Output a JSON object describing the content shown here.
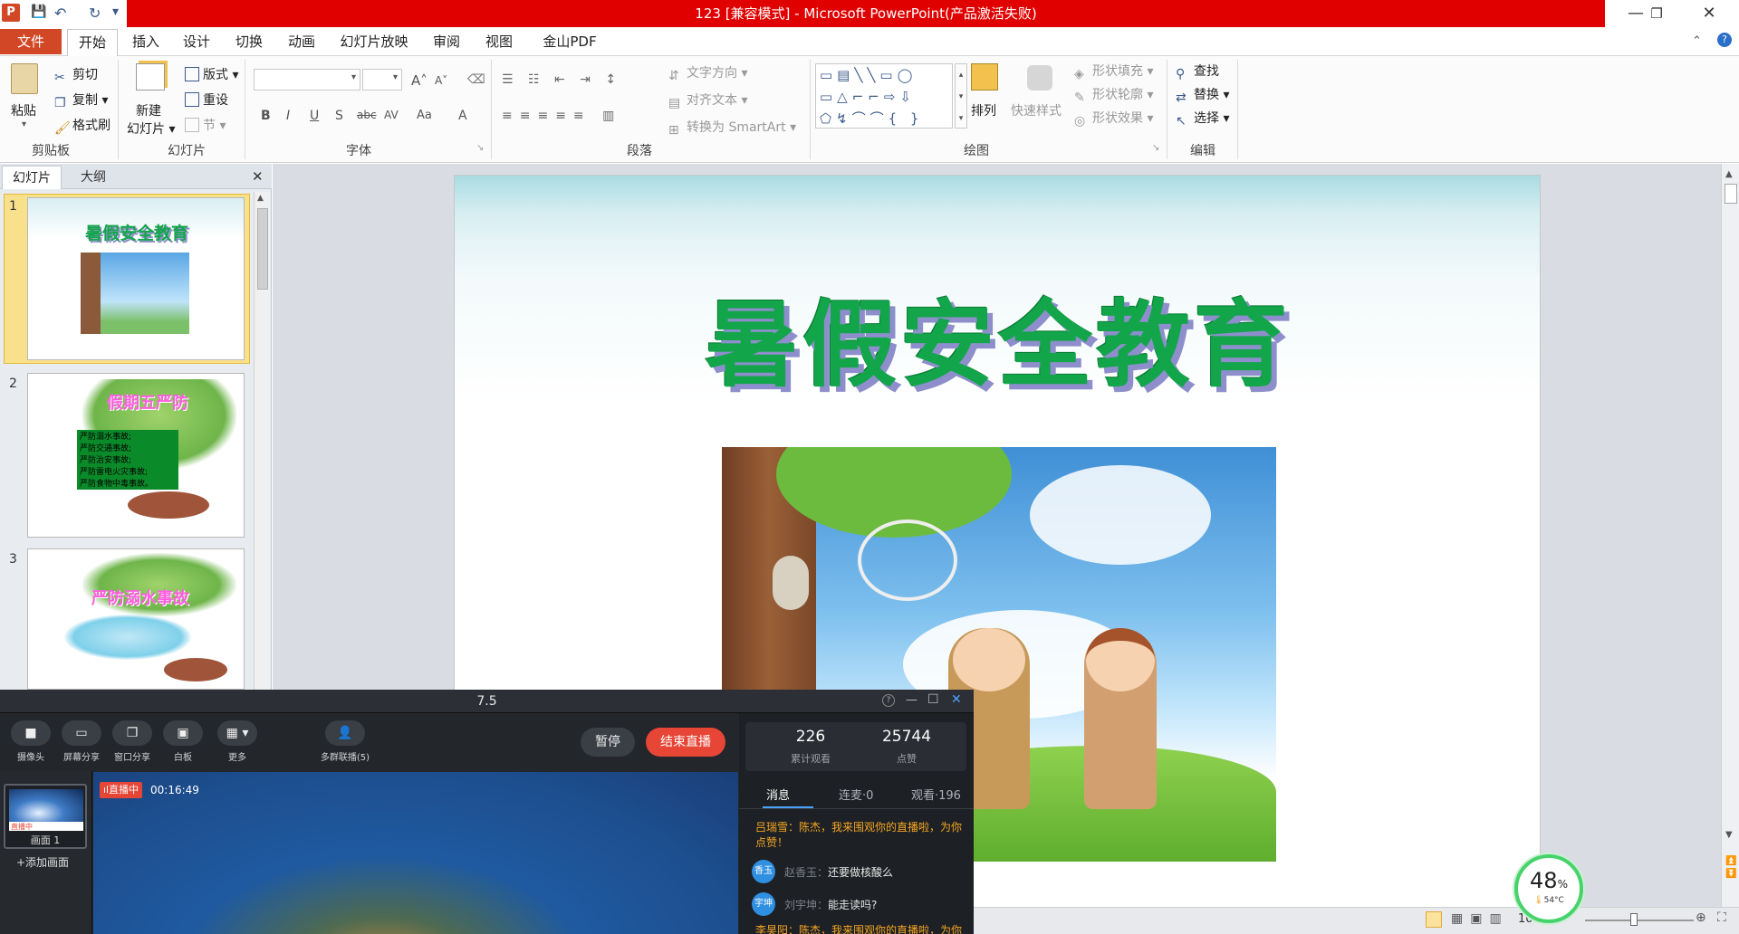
{
  "window": {
    "title": "123 [兼容模式] - Microsoft PowerPoint(产品激活失败)",
    "app_icon": "P",
    "qa_save": "💾",
    "qa_undo": "↶",
    "qa_redo": "↻",
    "qa_dropdown": "▾"
  },
  "menu": {
    "file": "文件",
    "tabs": [
      "开始",
      "插入",
      "设计",
      "切换",
      "动画",
      "幻灯片放映",
      "审阅",
      "视图",
      "金山PDF"
    ]
  },
  "ribbon": {
    "clipboard": {
      "paste": "粘贴",
      "cut": "剪切",
      "copy": "复制",
      "format_painter": "格式刷",
      "label": "剪贴板"
    },
    "slides": {
      "new_slide_1": "新建",
      "new_slide_2": "幻灯片",
      "layout": "版式",
      "reset": "重设",
      "section": "节",
      "label": "幻灯片"
    },
    "font": {
      "label": "字体",
      "bold": "B",
      "italic": "I",
      "underline": "U",
      "strike": "S",
      "abc": "abc",
      "av": "AV",
      "aa": "Aa",
      "grow": "A",
      "shrink": "A",
      "color": "A"
    },
    "paragraph": {
      "text_direction": "文字方向",
      "align_text": "对齐文本",
      "smartart": "转换为 SmartArt",
      "label": "段落"
    },
    "drawing": {
      "arrange": "排列",
      "quick_styles": "快速样式",
      "shape_fill": "形状填充",
      "shape_outline": "形状轮廓",
      "shape_effects": "形状效果",
      "label": "绘图"
    },
    "editing": {
      "find": "查找",
      "replace": "替换",
      "select": "选择",
      "label": "编辑"
    }
  },
  "left_panel": {
    "tab_slides": "幻灯片",
    "tab_outline": "大纲",
    "close": "✕",
    "thumbs": [
      {
        "num": "1",
        "title": "暑假安全教育"
      },
      {
        "num": "2",
        "title": "假期五严防",
        "lines": [
          "严防溺水事故;",
          "严防交通事故;",
          "严防治安事故;",
          "严防雷电火灾事故;",
          "严防食物中毒事故。"
        ]
      },
      {
        "num": "3",
        "title": "严防溺水事故"
      }
    ]
  },
  "slide": {
    "title": "暑假安全教育"
  },
  "status": {
    "zoom": "10%"
  },
  "live": {
    "title": "7.5",
    "tools": [
      {
        "icon": "camera-icon",
        "glyph": "■",
        "label": "摄像头"
      },
      {
        "icon": "screen-share-icon",
        "glyph": "▭",
        "label": "屏幕分享"
      },
      {
        "icon": "window-share-icon",
        "glyph": "❐",
        "label": "窗口分享"
      },
      {
        "icon": "whiteboard-icon",
        "glyph": "▣",
        "label": "白板"
      },
      {
        "icon": "more-icon",
        "glyph": "▦ ▾",
        "label": "更多"
      },
      {
        "icon": "multi-stream-icon",
        "glyph": "👤",
        "label": "多群联播(5)"
      }
    ],
    "pause": "暂停",
    "end": "结束直播",
    "scene_badge": "直播中",
    "scene_name": "画面 1",
    "add_scene": "+添加画面",
    "live_badge": "直播中",
    "elapsed": "00:16:49",
    "stats": {
      "views": "226",
      "views_label": "累计观看",
      "likes": "25744",
      "likes_label": "点赞"
    },
    "chat_tabs": [
      "消息",
      "连麦·0",
      "观看·196"
    ],
    "messages": [
      {
        "type": "system",
        "text": "吕瑞雪：陈杰，我来围观你的直播啦，为你点赞！"
      },
      {
        "type": "user",
        "avatar": "香玉",
        "name": "赵香玉：",
        "text": "还要做核酸么"
      },
      {
        "type": "user",
        "avatar": "宇坤",
        "name": "刘宇坤：",
        "text": "能走读吗?"
      },
      {
        "type": "system",
        "text": "李昊阳：陈杰，我来围观你的直播啦，为你"
      }
    ],
    "win_help": "?",
    "win_min": "—",
    "win_max": "☐",
    "win_close": "✕"
  },
  "gauge": {
    "value": "48",
    "unit": "%",
    "temp": "54°C"
  },
  "colors": {
    "title_bar": "#e00000",
    "file_tab": "#d24726",
    "slide_title": "#12a54a",
    "end_button": "#e74536",
    "gauge_ring": "#47d36b"
  }
}
